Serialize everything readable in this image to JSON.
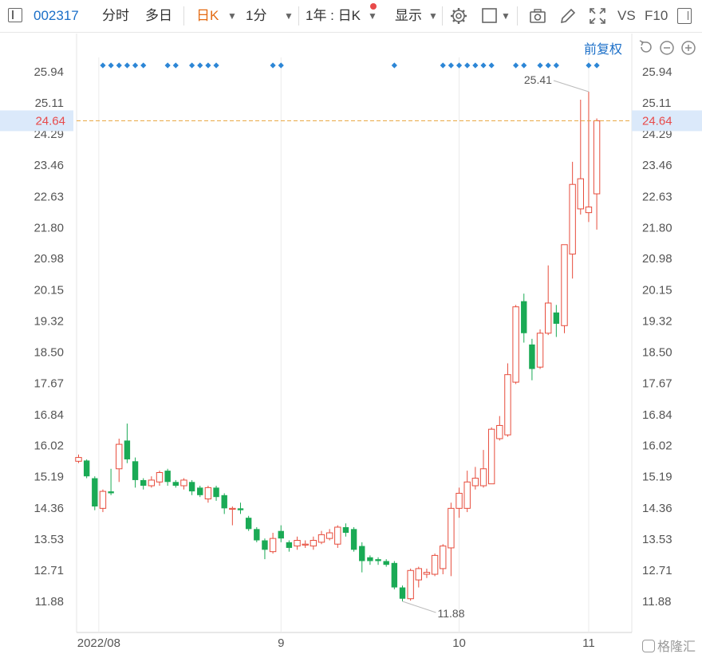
{
  "toolbar": {
    "code": "002317",
    "tab_minute": "分时",
    "tab_multiday": "多日",
    "tab_daily": "日K",
    "tab_1min": "1分",
    "range": "1年 : 日K",
    "display": "显示",
    "vs": "VS",
    "f10": "F10"
  },
  "adjust_label": "前复权",
  "colors": {
    "up": "#e74c3c",
    "down": "#1aaa55",
    "accent": "#1b6fc8",
    "current_line": "#e8a33a",
    "current_text": "#e84a4a"
  },
  "watermark": "格隆汇",
  "chart_data": {
    "type": "candlestick",
    "y_ticks": [
      "25.94",
      "25.11",
      "24.29",
      "23.46",
      "22.63",
      "21.80",
      "20.98",
      "20.15",
      "19.32",
      "18.50",
      "17.67",
      "16.84",
      "16.02",
      "15.19",
      "14.36",
      "13.53",
      "12.71",
      "11.88"
    ],
    "ylim": [
      11.4,
      26.6
    ],
    "x_labels": [
      {
        "label": "2022/08",
        "index": 2.5
      },
      {
        "label": "9",
        "index": 25
      },
      {
        "label": "10",
        "index": 47
      },
      {
        "label": "11",
        "index": 63
      }
    ],
    "current_price": "24.64",
    "max_label": "25.41",
    "min_label": "11.88",
    "markers": [
      3,
      4,
      5,
      6,
      7,
      8,
      11,
      12,
      14,
      15,
      16,
      17,
      24,
      25,
      39,
      45,
      46,
      47,
      48,
      49,
      50,
      51,
      54,
      55,
      57,
      58,
      59,
      63,
      64
    ],
    "candles": [
      {
        "o": 15.6,
        "c": 15.7,
        "h": 15.78,
        "l": 15.55
      },
      {
        "o": 15.62,
        "c": 15.2,
        "h": 15.65,
        "l": 15.15
      },
      {
        "o": 15.15,
        "c": 14.4,
        "h": 15.2,
        "l": 14.3
      },
      {
        "o": 14.35,
        "c": 14.8,
        "h": 14.85,
        "l": 14.25
      },
      {
        "o": 14.8,
        "c": 14.75,
        "h": 15.4,
        "l": 14.7
      },
      {
        "o": 15.4,
        "c": 16.05,
        "h": 16.2,
        "l": 15.05
      },
      {
        "o": 16.15,
        "c": 15.65,
        "h": 16.6,
        "l": 15.55
      },
      {
        "o": 15.6,
        "c": 15.1,
        "h": 15.7,
        "l": 14.9
      },
      {
        "o": 15.1,
        "c": 14.95,
        "h": 15.15,
        "l": 14.85
      },
      {
        "o": 14.95,
        "c": 15.1,
        "h": 15.2,
        "l": 14.9
      },
      {
        "o": 15.05,
        "c": 15.3,
        "h": 15.35,
        "l": 14.95
      },
      {
        "o": 15.35,
        "c": 15.05,
        "h": 15.4,
        "l": 14.95
      },
      {
        "o": 15.05,
        "c": 14.95,
        "h": 15.1,
        "l": 14.9
      },
      {
        "o": 14.95,
        "c": 15.1,
        "h": 15.15,
        "l": 14.85
      },
      {
        "o": 15.05,
        "c": 14.8,
        "h": 15.1,
        "l": 14.7
      },
      {
        "o": 14.9,
        "c": 14.7,
        "h": 14.95,
        "l": 14.65
      },
      {
        "o": 14.6,
        "c": 14.9,
        "h": 14.95,
        "l": 14.5
      },
      {
        "o": 14.9,
        "c": 14.65,
        "h": 14.95,
        "l": 14.55
      },
      {
        "o": 14.7,
        "c": 14.35,
        "h": 14.75,
        "l": 14.2
      },
      {
        "o": 14.35,
        "c": 14.35,
        "h": 14.4,
        "l": 13.9
      },
      {
        "o": 14.35,
        "c": 14.3,
        "h": 14.5,
        "l": 14.2
      },
      {
        "o": 14.1,
        "c": 13.8,
        "h": 14.15,
        "l": 13.75
      },
      {
        "o": 13.8,
        "c": 13.5,
        "h": 13.85,
        "l": 13.45
      },
      {
        "o": 13.5,
        "c": 13.25,
        "h": 13.55,
        "l": 13.0
      },
      {
        "o": 13.2,
        "c": 13.55,
        "h": 13.7,
        "l": 13.15
      },
      {
        "o": 13.75,
        "c": 13.55,
        "h": 13.9,
        "l": 13.45
      },
      {
        "o": 13.45,
        "c": 13.3,
        "h": 13.5,
        "l": 13.2
      },
      {
        "o": 13.35,
        "c": 13.5,
        "h": 13.6,
        "l": 13.25
      },
      {
        "o": 13.4,
        "c": 13.4,
        "h": 13.5,
        "l": 13.3
      },
      {
        "o": 13.35,
        "c": 13.5,
        "h": 13.6,
        "l": 13.25
      },
      {
        "o": 13.45,
        "c": 13.65,
        "h": 13.75,
        "l": 13.4
      },
      {
        "o": 13.55,
        "c": 13.7,
        "h": 13.8,
        "l": 13.5
      },
      {
        "o": 13.4,
        "c": 13.85,
        "h": 13.9,
        "l": 13.3
      },
      {
        "o": 13.85,
        "c": 13.7,
        "h": 13.95,
        "l": 13.6
      },
      {
        "o": 13.8,
        "c": 13.25,
        "h": 13.85,
        "l": 13.2
      },
      {
        "o": 13.35,
        "c": 12.95,
        "h": 13.45,
        "l": 12.65
      },
      {
        "o": 13.05,
        "c": 12.95,
        "h": 13.1,
        "l": 12.85
      },
      {
        "o": 13.0,
        "c": 12.95,
        "h": 13.05,
        "l": 12.85
      },
      {
        "o": 12.95,
        "c": 12.85,
        "h": 13.0,
        "l": 12.8
      },
      {
        "o": 12.9,
        "c": 12.25,
        "h": 12.95,
        "l": 12.2
      },
      {
        "o": 12.25,
        "c": 11.95,
        "h": 12.3,
        "l": 11.88
      },
      {
        "o": 11.95,
        "c": 12.7,
        "h": 12.75,
        "l": 11.9
      },
      {
        "o": 12.45,
        "c": 12.75,
        "h": 12.8,
        "l": 12.25
      },
      {
        "o": 12.6,
        "c": 12.65,
        "h": 12.75,
        "l": 12.5
      },
      {
        "o": 12.6,
        "c": 13.1,
        "h": 13.15,
        "l": 12.55
      },
      {
        "o": 12.75,
        "c": 13.35,
        "h": 13.4,
        "l": 12.6
      },
      {
        "o": 13.3,
        "c": 14.35,
        "h": 14.5,
        "l": 12.55
      },
      {
        "o": 14.35,
        "c": 14.75,
        "h": 14.9,
        "l": 14.1
      },
      {
        "o": 14.35,
        "c": 15.05,
        "h": 15.35,
        "l": 14.25
      },
      {
        "o": 14.95,
        "c": 15.15,
        "h": 15.45,
        "l": 14.85
      },
      {
        "o": 14.95,
        "c": 15.4,
        "h": 15.9,
        "l": 14.9
      },
      {
        "o": 15.0,
        "c": 16.45,
        "h": 16.5,
        "l": 15.0
      },
      {
        "o": 16.2,
        "c": 16.55,
        "h": 16.8,
        "l": 16.15
      },
      {
        "o": 16.3,
        "c": 17.9,
        "h": 18.2,
        "l": 16.25
      },
      {
        "o": 17.7,
        "c": 19.7,
        "h": 19.75,
        "l": 17.65
      },
      {
        "o": 19.85,
        "c": 19.0,
        "h": 20.05,
        "l": 18.75
      },
      {
        "o": 18.7,
        "c": 18.05,
        "h": 18.85,
        "l": 17.75
      },
      {
        "o": 18.1,
        "c": 19.0,
        "h": 19.1,
        "l": 18.05
      },
      {
        "o": 19.0,
        "c": 19.8,
        "h": 20.8,
        "l": 18.95
      },
      {
        "o": 19.55,
        "c": 19.25,
        "h": 19.75,
        "l": 18.9
      },
      {
        "o": 19.2,
        "c": 21.35,
        "h": 21.35,
        "l": 19.0
      },
      {
        "o": 21.1,
        "c": 22.95,
        "h": 23.55,
        "l": 20.45
      },
      {
        "o": 22.3,
        "c": 23.1,
        "h": 25.2,
        "l": 22.15
      },
      {
        "o": 22.2,
        "c": 22.35,
        "h": 25.41,
        "l": 21.95
      },
      {
        "o": 22.7,
        "c": 24.64,
        "h": 24.7,
        "l": 21.75
      }
    ]
  }
}
